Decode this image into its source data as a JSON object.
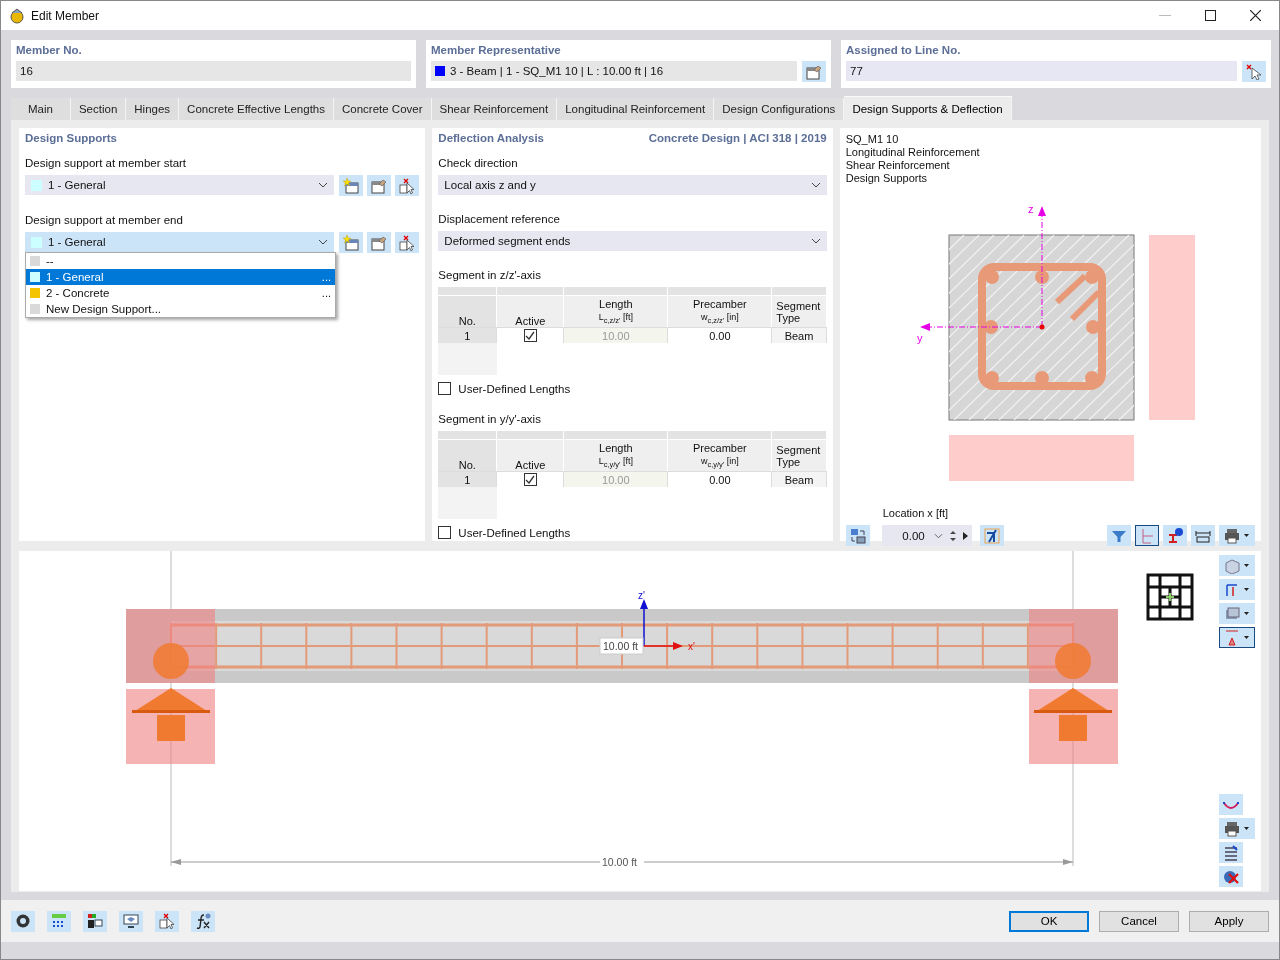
{
  "window": {
    "title": "Edit Member"
  },
  "header": {
    "member_no": {
      "label": "Member No.",
      "value": "16"
    },
    "member_representative": {
      "label": "Member Representative",
      "value": "3 - Beam | 1 - SQ_M1 10 | L : 10.00 ft | 16",
      "color": "#0000ff"
    },
    "assigned_line": {
      "label": "Assigned to Line No.",
      "value": "77"
    }
  },
  "tabs": [
    {
      "label": "Main",
      "selected": false
    },
    {
      "label": "Section",
      "selected": false
    },
    {
      "label": "Hinges",
      "selected": false
    },
    {
      "label": "Concrete Effective Lengths",
      "selected": false
    },
    {
      "label": "Concrete Cover",
      "selected": false
    },
    {
      "label": "Shear Reinforcement",
      "selected": false
    },
    {
      "label": "Longitudinal Reinforcement",
      "selected": false
    },
    {
      "label": "Design Configurations",
      "selected": false
    },
    {
      "label": "Design Supports & Deflection",
      "selected": true
    }
  ],
  "design_supports": {
    "title": "Design Supports",
    "start": {
      "label": "Design support at member start",
      "value": "1 - General",
      "color": "#ccffff"
    },
    "end": {
      "label": "Design support at member end",
      "value": "1 - General",
      "color": "#ccffff",
      "expanded": true
    },
    "options": [
      {
        "label": "--",
        "color": "#d9d9d9",
        "selected": false
      },
      {
        "label": "1 - General",
        "color": "#ccffff",
        "selected": true,
        "more": "..."
      },
      {
        "label": "2 - Concrete",
        "color": "#f5c400",
        "selected": false,
        "more": "..."
      },
      {
        "label": "New Design Support...",
        "color": "#d9d9d9",
        "selected": false
      }
    ]
  },
  "deflection": {
    "title": "Deflection Analysis",
    "standard": "Concrete Design | ACI 318 | 2019",
    "check_direction": {
      "label": "Check direction",
      "value": "Local axis z and y"
    },
    "displacement_reference": {
      "label": "Displacement reference",
      "value": "Deformed segment ends"
    },
    "segments": [
      {
        "title": "Segment in z/z'-axis",
        "columns": [
          {
            "label": "No."
          },
          {
            "label": "Active"
          },
          {
            "label": "Length",
            "symbol": "L$_{c,z/z'}$ [ft]"
          },
          {
            "label": "Precamber",
            "symbol": "w$_{c,z/z'}$ [in]"
          },
          {
            "label": "Segment Type"
          }
        ],
        "rows": [
          {
            "no": "1",
            "active": true,
            "length": "10.00",
            "precamber": "0.00",
            "type": "Beam"
          }
        ],
        "user_defined": {
          "label": "User-Defined Lengths",
          "checked": false
        }
      },
      {
        "title": "Segment in y/y'-axis",
        "columns": [
          {
            "label": "No."
          },
          {
            "label": "Active"
          },
          {
            "label": "Length",
            "symbol": "L$_{c,y/y'}$ [ft]"
          },
          {
            "label": "Precamber",
            "symbol": "w$_{c,y/y'}$ [in]"
          },
          {
            "label": "Segment Type"
          }
        ],
        "rows": [
          {
            "no": "1",
            "active": true,
            "length": "10.00",
            "precamber": "0.00",
            "type": "Beam"
          }
        ],
        "user_defined": {
          "label": "User-Defined Lengths",
          "checked": false
        }
      }
    ]
  },
  "section_view": {
    "info_lines": [
      "SQ_M1 10",
      "Longitudinal Reinforcement",
      "Shear Reinforcement",
      "Design Supports"
    ],
    "axis_z": "z",
    "axis_y": "y",
    "location": {
      "label": "Location x [ft]",
      "value": "0.00"
    }
  },
  "member_view": {
    "axis_z": "z'",
    "axis_x": "x'",
    "length_label": "10.00 ft",
    "dimension": "10.00 ft"
  },
  "buttons": [
    "OK",
    "Cancel",
    "Apply"
  ]
}
